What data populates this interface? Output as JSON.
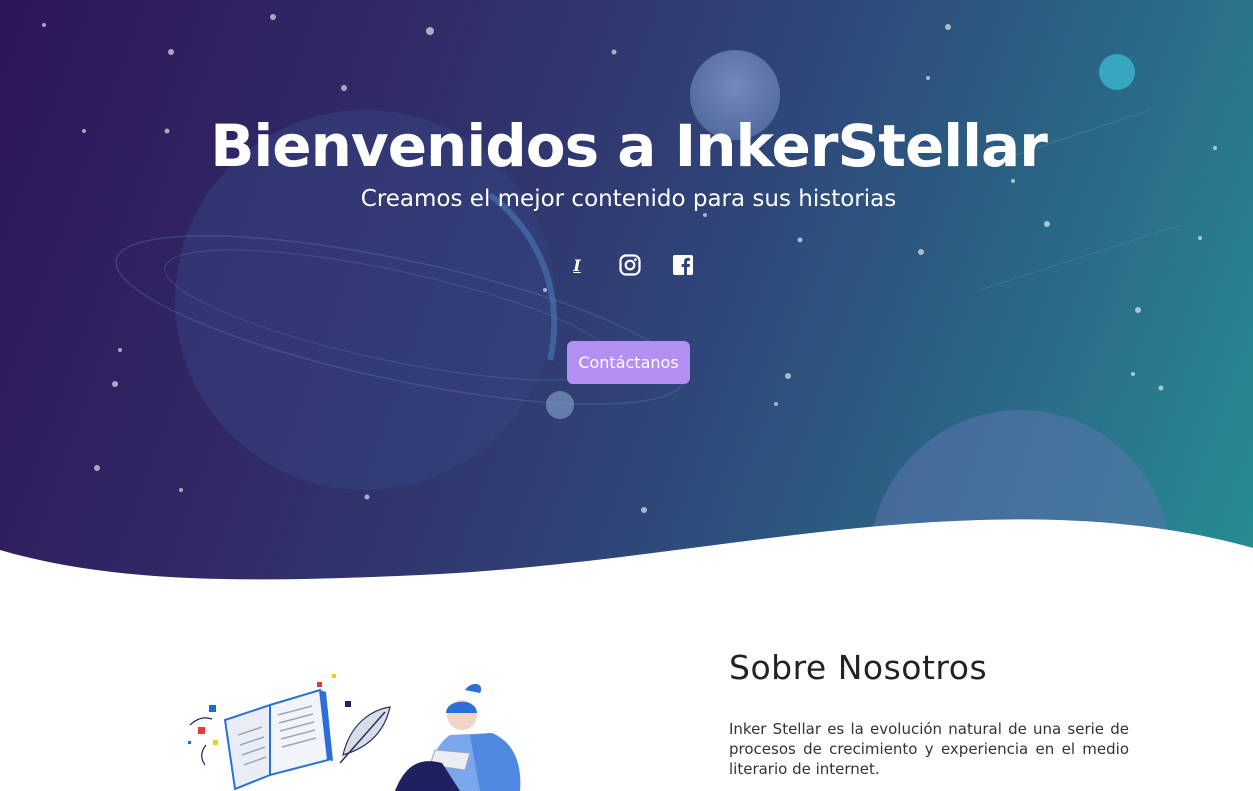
{
  "hero": {
    "title": "Bienvenidos a InkerStellar",
    "subtitle": "Creamos el mejor contenido para sus historias",
    "contact_button": "Contáctanos",
    "socials": [
      {
        "name": "inkerstellar",
        "icon": "inker-icon"
      },
      {
        "name": "instagram",
        "icon": "instagram-icon"
      },
      {
        "name": "facebook",
        "icon": "facebook-icon"
      }
    ],
    "inker_glyph": "I"
  },
  "about": {
    "title": "Sobre Nosotros",
    "text": "Inker Stellar es la evolución natural de una serie de procesos de crecimiento y experiencia en el medio literario de internet."
  },
  "colors": {
    "button": "#b28ff0",
    "gradient_start": "#2e1559",
    "gradient_end": "#288d93"
  }
}
